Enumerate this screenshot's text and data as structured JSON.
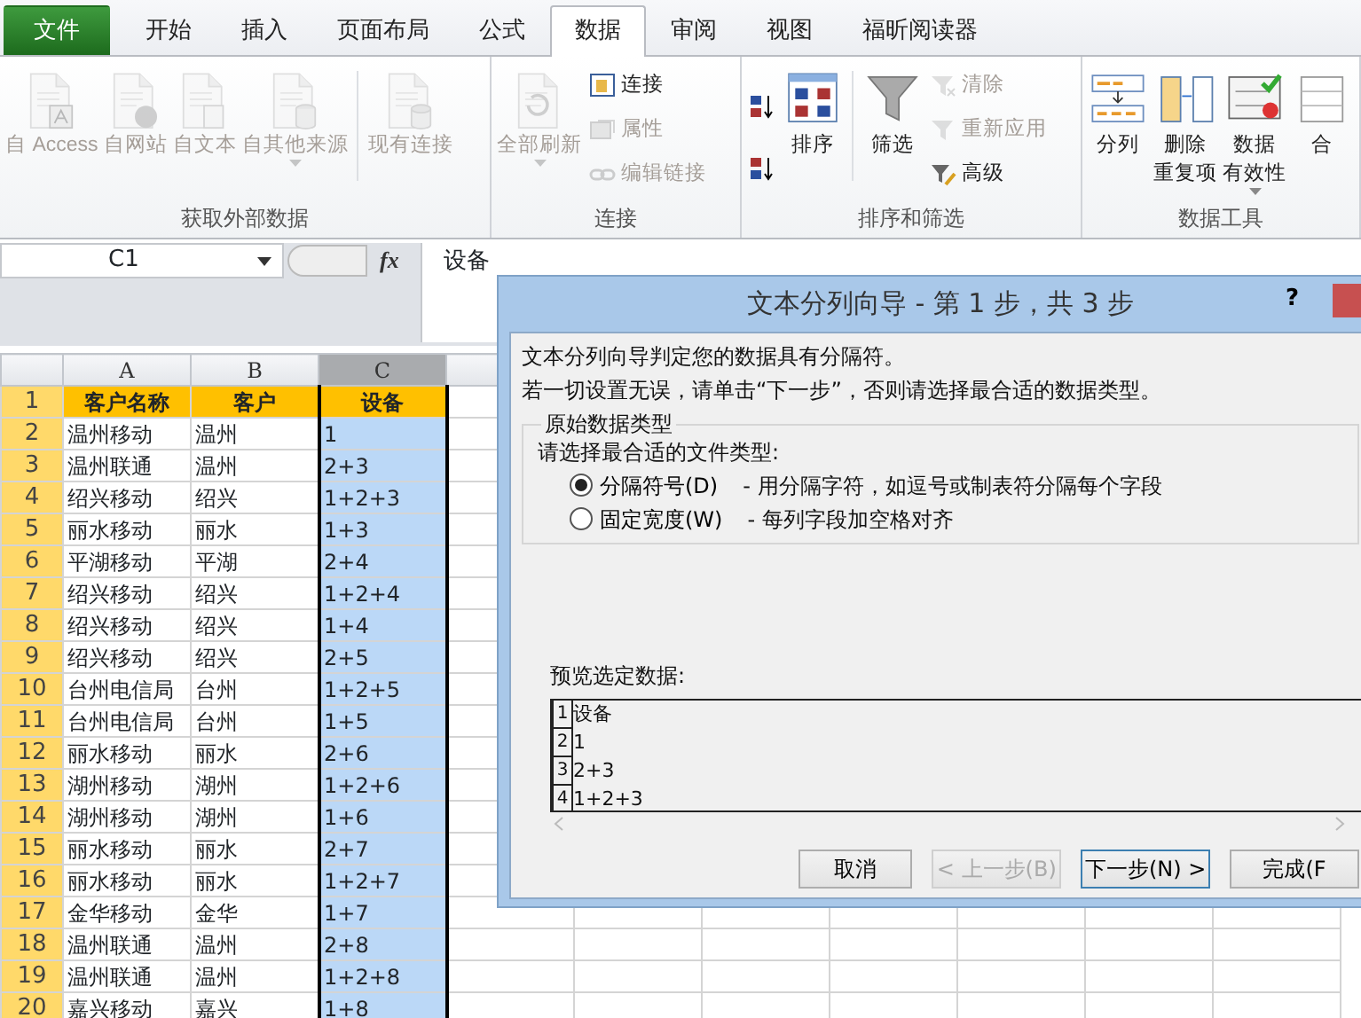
{
  "tabs": [
    {
      "label": "文件",
      "kind": "file",
      "selected": false
    },
    {
      "label": "开始",
      "kind": "tab",
      "selected": false
    },
    {
      "label": "插入",
      "kind": "tab",
      "selected": false
    },
    {
      "label": "页面布局",
      "kind": "tab",
      "selected": false
    },
    {
      "label": "公式",
      "kind": "tab",
      "selected": false
    },
    {
      "label": "数据",
      "kind": "tab",
      "selected": true
    },
    {
      "label": "审阅",
      "kind": "tab",
      "selected": false
    },
    {
      "label": "视图",
      "kind": "tab",
      "selected": false
    },
    {
      "label": "福昕阅读器",
      "kind": "tab",
      "selected": false
    }
  ],
  "ribbon": [
    {
      "label": "获取外部数据",
      "items": [
        {
          "kind": "large",
          "lines": [
            "自 Access"
          ],
          "disabled": true
        },
        {
          "kind": "large",
          "lines": [
            "自网站"
          ],
          "disabled": true
        },
        {
          "kind": "large",
          "lines": [
            "自文本"
          ],
          "disabled": true
        },
        {
          "kind": "large",
          "lines": [
            "自其他来源"
          ],
          "disabled": true,
          "dropdown": true
        },
        {
          "kind": "separator"
        },
        {
          "kind": "large",
          "lines": [
            "现有连接"
          ],
          "disabled": true
        }
      ]
    },
    {
      "label": "连接",
      "items": [
        {
          "kind": "large",
          "lines": [
            "全部刷新"
          ],
          "disabled": true,
          "dropdown": true
        },
        {
          "kind": "stack",
          "children": [
            {
              "label": "连接",
              "disabled": false
            },
            {
              "label": "属性",
              "disabled": true
            },
            {
              "label": "编辑链接",
              "disabled": true
            }
          ]
        }
      ]
    },
    {
      "label": "排序和筛选",
      "items": [
        {
          "kind": "stack",
          "children": [
            {
              "disabled": false
            },
            {
              "disabled": false
            }
          ]
        },
        {
          "kind": "large",
          "lines": [
            "排序"
          ],
          "disabled": false
        },
        {
          "kind": "separator"
        },
        {
          "kind": "large",
          "lines": [
            "筛选"
          ],
          "disabled": false
        },
        {
          "kind": "stack",
          "children": [
            {
              "label": "清除",
              "disabled": true
            },
            {
              "label": "重新应用",
              "disabled": true
            },
            {
              "label": "高级",
              "disabled": false
            }
          ]
        }
      ]
    },
    {
      "label": "数据工具",
      "items": [
        {
          "kind": "large",
          "lines": [
            "分列"
          ],
          "disabled": false
        },
        {
          "kind": "large",
          "lines": [
            "删除",
            "重复项"
          ],
          "disabled": false
        },
        {
          "kind": "large",
          "lines": [
            "数据",
            "有效性"
          ],
          "disabled": false,
          "dropdown": true
        },
        {
          "kind": "large",
          "lines": [
            "合"
          ],
          "disabled": false
        }
      ]
    }
  ],
  "name_box": "C1",
  "function_button": "fx",
  "formula": "设备",
  "columns": [
    {
      "label": "A",
      "selected": false
    },
    {
      "label": "B",
      "selected": false
    },
    {
      "label": "C",
      "selected": true
    }
  ],
  "rows": [
    {
      "num": "1",
      "kind": "header",
      "cells": [
        "客户名称",
        "客户",
        "设备"
      ]
    },
    {
      "num": "2",
      "kind": "data",
      "cells": [
        "温州移动",
        "温州",
        "1"
      ]
    },
    {
      "num": "3",
      "kind": "data",
      "cells": [
        "温州联通",
        "温州",
        "2+3"
      ]
    },
    {
      "num": "4",
      "kind": "data",
      "cells": [
        "绍兴移动",
        "绍兴",
        "1+2+3"
      ]
    },
    {
      "num": "5",
      "kind": "data",
      "cells": [
        "丽水移动",
        "丽水",
        "1+3"
      ]
    },
    {
      "num": "6",
      "kind": "data",
      "cells": [
        "平湖移动",
        "平湖",
        "2+4"
      ]
    },
    {
      "num": "7",
      "kind": "data",
      "cells": [
        "绍兴移动",
        "绍兴",
        "1+2+4"
      ]
    },
    {
      "num": "8",
      "kind": "data",
      "cells": [
        "绍兴移动",
        "绍兴",
        "1+4"
      ]
    },
    {
      "num": "9",
      "kind": "data",
      "cells": [
        "绍兴移动",
        "绍兴",
        "2+5"
      ]
    },
    {
      "num": "10",
      "kind": "data",
      "cells": [
        "台州电信局",
        "台州",
        "1+2+5"
      ]
    },
    {
      "num": "11",
      "kind": "data",
      "cells": [
        "台州电信局",
        "台州",
        "1+5"
      ]
    },
    {
      "num": "12",
      "kind": "data",
      "cells": [
        "丽水移动",
        "丽水",
        "2+6"
      ]
    },
    {
      "num": "13",
      "kind": "data",
      "cells": [
        "湖州移动",
        "湖州",
        "1+2+6"
      ]
    },
    {
      "num": "14",
      "kind": "data",
      "cells": [
        "湖州移动",
        "湖州",
        "1+6"
      ]
    },
    {
      "num": "15",
      "kind": "data",
      "cells": [
        "丽水移动",
        "丽水",
        "2+7"
      ]
    },
    {
      "num": "16",
      "kind": "data",
      "cells": [
        "丽水移动",
        "丽水",
        "1+2+7"
      ]
    },
    {
      "num": "17",
      "kind": "data",
      "cells": [
        "金华移动",
        "金华",
        "1+7"
      ]
    },
    {
      "num": "18",
      "kind": "data",
      "cells": [
        "温州联通",
        "温州",
        "2+8"
      ]
    },
    {
      "num": "19",
      "kind": "data",
      "cells": [
        "温州联通",
        "温州",
        "1+2+8"
      ]
    },
    {
      "num": "20",
      "kind": "data",
      "cells": [
        "嘉兴移动",
        "嘉兴",
        "1+8"
      ]
    }
  ],
  "dialog": {
    "title": "文本分列向导 - 第 1 步，共 3 步",
    "help": "?",
    "intro": [
      "文本分列向导判定您的数据具有分隔符。",
      "若一切设置无误，请单击“下一步”，否则请选择最合适的数据类型。"
    ],
    "group_label": "原始数据类型",
    "prompt": "请选择最合适的文件类型:",
    "options": [
      {
        "label": "分隔符号(D)",
        "description": "- 用分隔字符，如逗号或制表符分隔每个字段",
        "selected": true
      },
      {
        "label": "固定宽度(W)",
        "description": "- 每列字段加空格对齐",
        "selected": false
      }
    ],
    "preview_label": "预览选定数据:",
    "preview": [
      {
        "num": "1",
        "text": "设备"
      },
      {
        "num": "2",
        "text": "1"
      },
      {
        "num": "3",
        "text": "2+3"
      },
      {
        "num": "4",
        "text": "1+2+3"
      }
    ],
    "buttons": [
      {
        "label": "取消",
        "disabled": false,
        "default": false
      },
      {
        "label": "< 上一步(B)",
        "disabled": true,
        "default": false
      },
      {
        "label": "下一步(N) >",
        "disabled": false,
        "default": true
      },
      {
        "label": "完成(F",
        "disabled": false,
        "default": false
      }
    ]
  }
}
